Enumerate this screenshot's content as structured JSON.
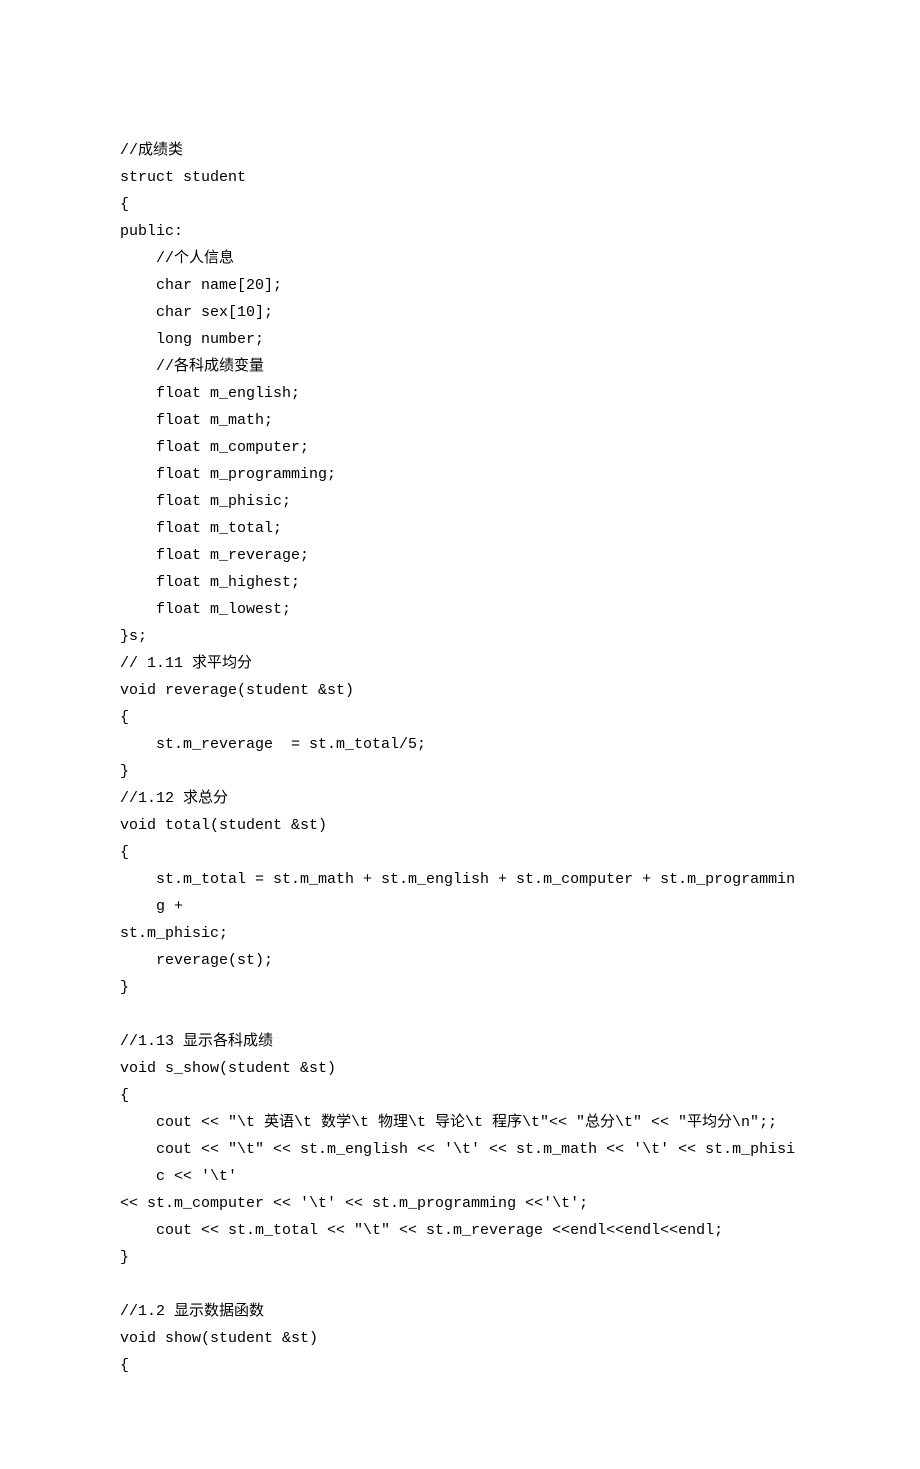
{
  "code": {
    "l01": "//成绩类",
    "l02": "struct student",
    "l03": "{",
    "l04": "public:",
    "l05": "//个人信息",
    "l06": "char name[20];",
    "l07": "char sex[10];",
    "l08": "long number;",
    "l09": "//各科成绩变量",
    "l10": "float m_english;",
    "l11": "float m_math;",
    "l12": "float m_computer;",
    "l13": "float m_programming;",
    "l14": "float m_phisic;",
    "l15": "float m_total;",
    "l16": "float m_reverage;",
    "l17": "float m_highest;",
    "l18": "float m_lowest;",
    "l19": "}s;",
    "l20": "// 1.11 求平均分",
    "l21": "void reverage(student &st)",
    "l22": "{",
    "l23": "st.m_reverage  = st.m_total/5;",
    "l24": "}",
    "l25": "//1.12 求总分",
    "l26": "void total(student &st)",
    "l27": "{",
    "l28a": "st.m_total = st.m_math + st.m_english + st.m_computer + st.m_programming + ",
    "l28b": "st.m_phisic;",
    "l29": "reverage(st);",
    "l30": "}",
    "l31": "",
    "l32": "//1.13 显示各科成绩",
    "l33": "void s_show(student &st)",
    "l34": "{",
    "l35": "cout << \"\\t 英语\\t 数学\\t 物理\\t 导论\\t 程序\\t\"<< \"总分\\t\" << \"平均分\\n\";;",
    "l36a": "cout << \"\\t\" << st.m_english << '\\t' << st.m_math << '\\t' << st.m_phisic << '\\t' ",
    "l36b": "<< st.m_computer << '\\t' << st.m_programming <<'\\t';",
    "l37": "cout << st.m_total << \"\\t\" << st.m_reverage <<endl<<endl<<endl;",
    "l38": "}",
    "l39": "",
    "l40": "//1.2 显示数据函数",
    "l41": "void show(student &st)",
    "l42": "{"
  }
}
